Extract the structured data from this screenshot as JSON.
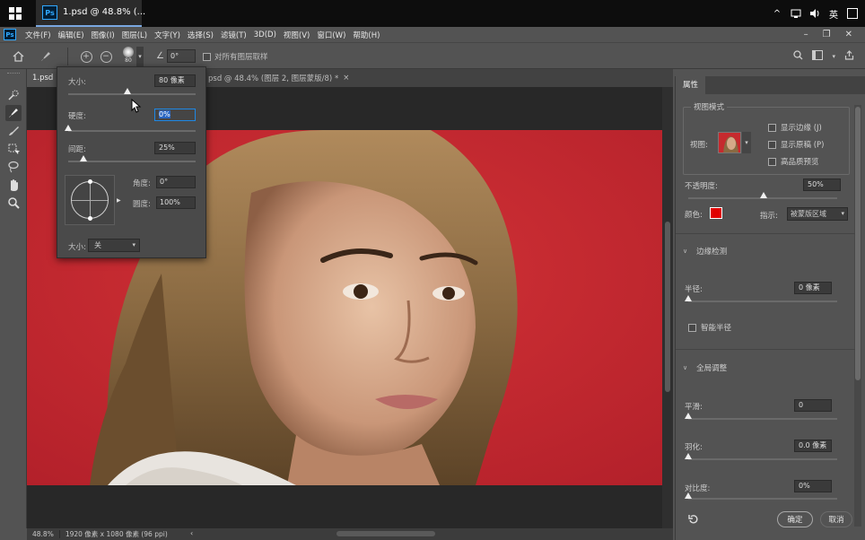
{
  "taskbar": {
    "app_title": "1.psd @ 48.8% (...",
    "ime": "英",
    "icons": [
      "chevron-up-icon",
      "network-icon",
      "volume-icon",
      "ime-icon",
      "notification-icon"
    ]
  },
  "menubar": {
    "app_badge": "Ps",
    "items": [
      "文件(F)",
      "编辑(E)",
      "图像(I)",
      "图层(L)",
      "文字(Y)",
      "选择(S)",
      "滤镜(T)",
      "3D(D)",
      "视图(V)",
      "窗口(W)",
      "帮助(H)"
    ]
  },
  "options": {
    "brush_size": "80",
    "angle": "0°",
    "sample_all_layers": "对所有图层取样"
  },
  "tabs": {
    "tab1": "1.psd",
    "tab2": "psd @ 48.4% (图层 2, 图层蒙版/8) *",
    "tab2_close": "×"
  },
  "brush_popup": {
    "size_label": "大小:",
    "size_value": "80 像素",
    "hardness_label": "硬度:",
    "hardness_value": "0%",
    "spacing_label": "间距:",
    "spacing_value": "25%",
    "angle_label": "角度:",
    "angle_value": "0°",
    "roundness_label": "圆度:",
    "roundness_value": "100%",
    "size_control_label": "大小:",
    "size_control_value": "关"
  },
  "status": {
    "zoom": "48.8%",
    "doc_size": "1920 像素 x 1080 像素 (96 ppi)"
  },
  "panel": {
    "tab": "属性",
    "view_mode_title": "视图模式",
    "view_label": "视图:",
    "show_edge": "显示边缘 (J)",
    "show_original": "显示原稿 (P)",
    "hq_preview": "高品质预览",
    "opacity_label": "不透明度:",
    "opacity_value": "50%",
    "color_label": "颜色:",
    "color_value": "#e00000",
    "indicate_label": "指示:",
    "indicate_value": "被蒙版区域",
    "edge_detection_title": "边缘检测",
    "radius_label": "半径:",
    "radius_value": "0 像素",
    "smart_radius": "智能半径",
    "global_refine_title": "全局调整",
    "smooth_label": "平滑:",
    "smooth_value": "0",
    "feather_label": "羽化:",
    "feather_value": "0.0 像素",
    "contrast_label": "对比度:",
    "contrast_value": "0%",
    "ok_label": "确定",
    "cancel_label": "取消"
  }
}
